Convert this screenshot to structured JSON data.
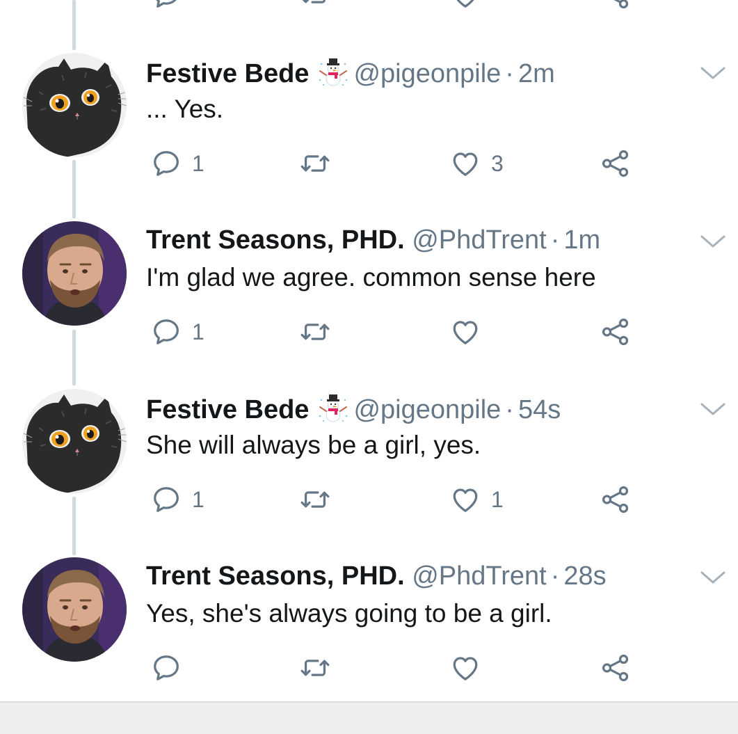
{
  "colors": {
    "text_primary": "#14171a",
    "text_secondary": "#657786",
    "thread_line": "#cfd9de",
    "icon": "#657786"
  },
  "icons": {
    "reply": "reply-icon",
    "retweet": "retweet-icon",
    "like": "heart-icon",
    "share": "share-icon",
    "menu": "chevron-down-icon",
    "name_emoji": "snowman-emoji-icon"
  },
  "tweets": [
    {
      "name": "Festive Bede",
      "has_emoji": true,
      "handle": "@pigeonpile",
      "separator": "·",
      "time": "2m",
      "text": "... Yes.",
      "reply_count": "1",
      "retweet_count": "",
      "like_count": "3",
      "avatar": "black-cat-avatar"
    },
    {
      "name": "Trent Seasons, PHD.",
      "has_emoji": false,
      "handle": "@PhdTrent",
      "separator": "·",
      "time": "1m",
      "text": "I'm glad we agree. common sense here",
      "reply_count": "1",
      "retweet_count": "",
      "like_count": "",
      "avatar": "man-portrait-avatar"
    },
    {
      "name": "Festive Bede",
      "has_emoji": true,
      "handle": "@pigeonpile",
      "separator": "·",
      "time": "54s",
      "text": "She will always be a girl, yes.",
      "reply_count": "1",
      "retweet_count": "",
      "like_count": "1",
      "avatar": "black-cat-avatar"
    },
    {
      "name": "Trent Seasons, PHD.",
      "has_emoji": false,
      "handle": "@PhdTrent",
      "separator": "·",
      "time": "28s",
      "text": "Yes, she's always going to be a girl.",
      "reply_count": "",
      "retweet_count": "",
      "like_count": "",
      "avatar": "man-portrait-avatar"
    }
  ]
}
